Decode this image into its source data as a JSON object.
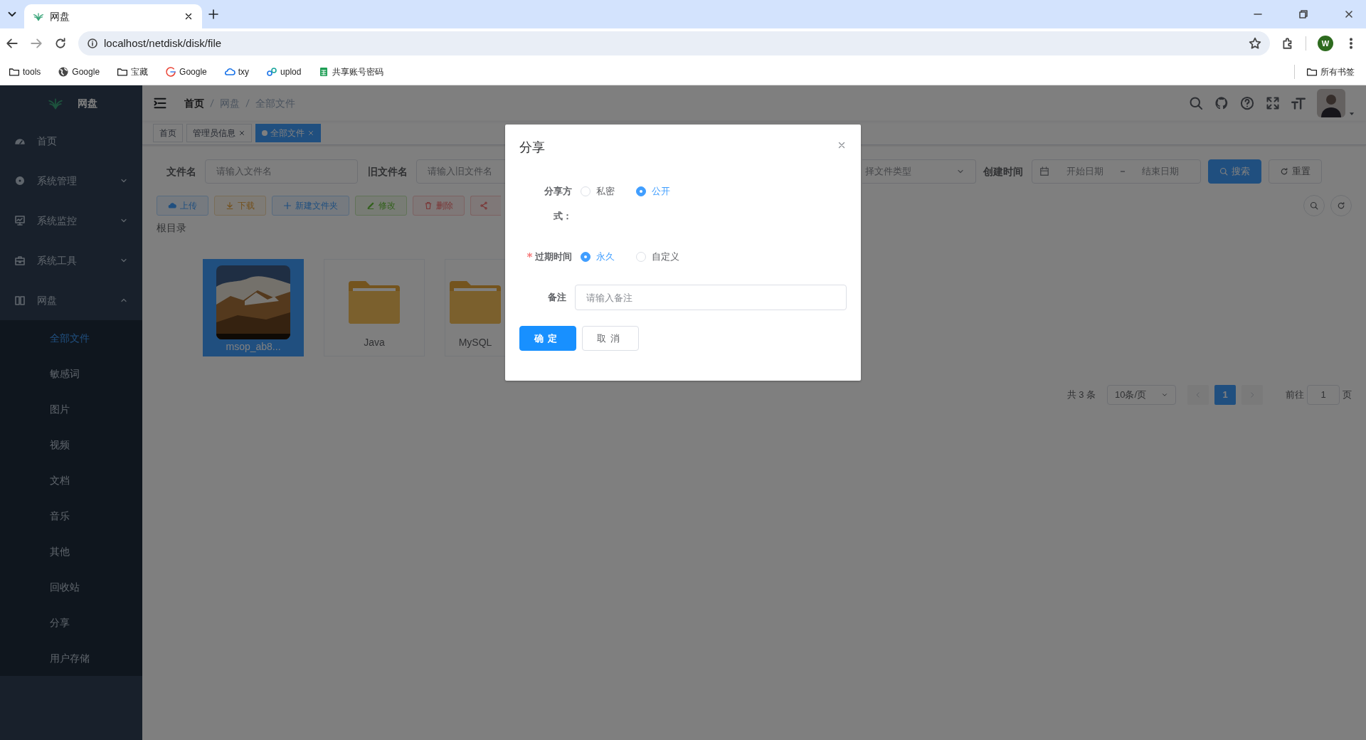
{
  "browser": {
    "tabs": [
      {
        "title": "网盘",
        "selected": true
      }
    ],
    "url": "localhost/netdisk/disk/file",
    "bookmarks": [
      {
        "label": "tools",
        "kind": "folder"
      },
      {
        "label": "Google",
        "kind": "site"
      },
      {
        "label": "宝藏",
        "kind": "folder"
      },
      {
        "label": "Google",
        "kind": "site"
      },
      {
        "label": "txy",
        "kind": "site"
      },
      {
        "label": "uplod",
        "kind": "site"
      },
      {
        "label": "共享账号密码",
        "kind": "site"
      }
    ],
    "all_bookmarks": "所有书签",
    "profile": "W"
  },
  "sidebar": {
    "title": "网盘",
    "items": [
      {
        "label": "首页",
        "kind": "link"
      },
      {
        "label": "系统管理",
        "kind": "menu",
        "expanded": false
      },
      {
        "label": "系统监控",
        "kind": "menu",
        "expanded": false
      },
      {
        "label": "系统工具",
        "kind": "menu",
        "expanded": false
      },
      {
        "label": "网盘",
        "kind": "menu",
        "expanded": true,
        "children": [
          {
            "label": "全部文件",
            "selected": true
          },
          {
            "label": "敏感词",
            "selected": false
          },
          {
            "label": "图片",
            "selected": false
          },
          {
            "label": "视频",
            "selected": false
          },
          {
            "label": "文档",
            "selected": false
          },
          {
            "label": "音乐",
            "selected": false
          },
          {
            "label": "其他",
            "selected": false
          },
          {
            "label": "回收站",
            "selected": false
          },
          {
            "label": "分享",
            "selected": false
          },
          {
            "label": "用户存储",
            "selected": false
          }
        ]
      }
    ]
  },
  "breadcrumb": [
    "首页",
    "网盘",
    "全部文件"
  ],
  "tags": [
    {
      "label": "首页",
      "selected": false,
      "closable": false
    },
    {
      "label": "管理员信息",
      "selected": false,
      "closable": true
    },
    {
      "label": "全部文件",
      "selected": true,
      "closable": true
    }
  ],
  "search_form": {
    "fields": [
      {
        "label": "文件名",
        "placeholder": "请输入文件名"
      },
      {
        "label": "旧文件名",
        "placeholder": "请输入旧文件名"
      }
    ],
    "file_type": {
      "placeholder": "择文件类型"
    },
    "created": {
      "label": "创建时间",
      "start_placeholder": "开始日期",
      "end_placeholder": "结束日期"
    },
    "buttons": [
      {
        "label": "搜索",
        "kind": "primary"
      },
      {
        "label": "重置",
        "kind": "plain"
      }
    ]
  },
  "toolbar": [
    {
      "label": "上传",
      "kind": "primary"
    },
    {
      "label": "下载",
      "kind": "warning"
    },
    {
      "label": "新建文件夹",
      "kind": "primary"
    },
    {
      "label": "修改",
      "kind": "success"
    },
    {
      "label": "删除",
      "kind": "danger"
    },
    {
      "kind": "danger"
    }
  ],
  "path": "根目录",
  "files": [
    {
      "name": "msop_ab8...",
      "kind": "picture",
      "selected": true
    },
    {
      "name": "Java",
      "kind": "folder",
      "selected": false
    },
    {
      "name": "MySQL",
      "kind": "folder",
      "selected": false
    }
  ],
  "pagination": {
    "total": "共 3 条",
    "page_size": "10条/页",
    "pages": [
      {
        "label": "1",
        "selected": true
      }
    ],
    "goto_label": "前往",
    "goto_value": "1",
    "goto_suffix": "页"
  },
  "dialog": {
    "title": "分享",
    "fields": [
      {
        "kind": "radio",
        "label": "分享方式：",
        "required": false,
        "options": [
          {
            "label": "私密",
            "selected": false
          },
          {
            "label": "公开",
            "selected": true
          }
        ]
      },
      {
        "kind": "radio",
        "label": "过期时间",
        "required": true,
        "options": [
          {
            "label": "永久",
            "selected": true
          },
          {
            "label": "自定义",
            "selected": false
          }
        ]
      },
      {
        "kind": "input",
        "label": "备注",
        "required": false,
        "placeholder": "请输入备注"
      }
    ],
    "buttons": [
      {
        "label": "确定",
        "kind": "primary"
      },
      {
        "label": "取消",
        "kind": "plain"
      }
    ]
  }
}
